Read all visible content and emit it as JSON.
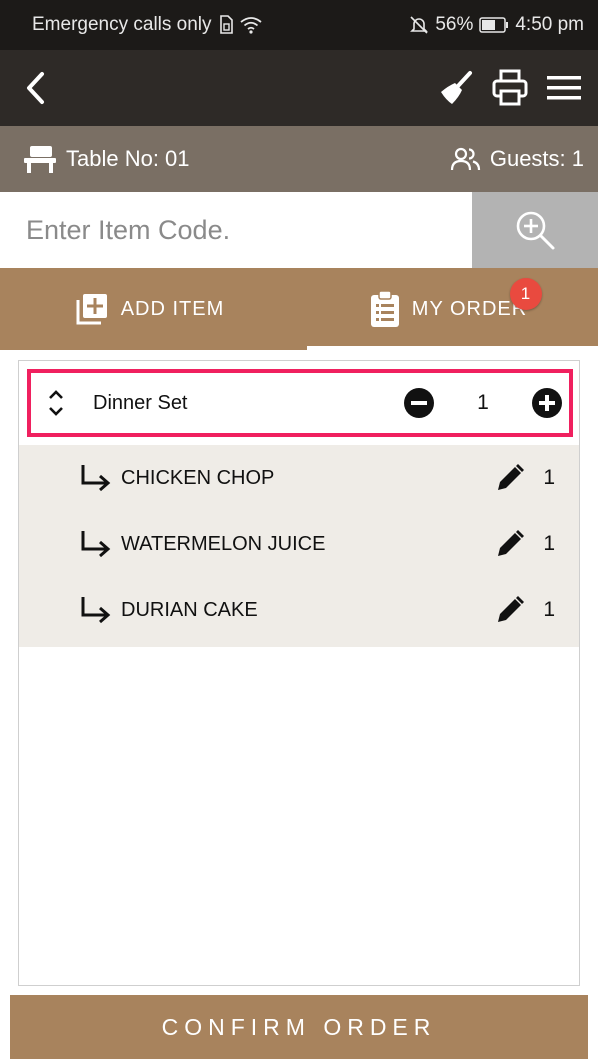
{
  "status_bar": {
    "carrier": "Emergency calls only",
    "battery": "56%",
    "time": "4:50 pm"
  },
  "toolbar": {
    "back_icon": "chevron-left-icon",
    "clear_icon": "broom-icon",
    "print_icon": "printer-icon",
    "menu_icon": "hamburger-menu-icon"
  },
  "info": {
    "table": "Table No: 01",
    "guests": "Guests: 1"
  },
  "search": {
    "placeholder": "Enter Item Code."
  },
  "tabs": [
    {
      "label": "ADD ITEM",
      "icon": "add-box-icon"
    },
    {
      "label": "MY ORDER",
      "icon": "clipboard-list-icon",
      "badge": "1"
    }
  ],
  "order": {
    "set": {
      "name": "Dinner Set",
      "qty": "1"
    },
    "items": [
      {
        "name": "CHICKEN CHOP",
        "qty": "1"
      },
      {
        "name": "WATERMELON JUICE",
        "qty": "1"
      },
      {
        "name": "DURIAN CAKE",
        "qty": "1"
      }
    ]
  },
  "confirm_label": "CONFIRM ORDER",
  "colors": {
    "accent": "#a8835d",
    "info_bar": "#7a6f64",
    "toolbar": "#2e2a27",
    "highlight": "#f0205f",
    "badge": "#e94a3f"
  }
}
